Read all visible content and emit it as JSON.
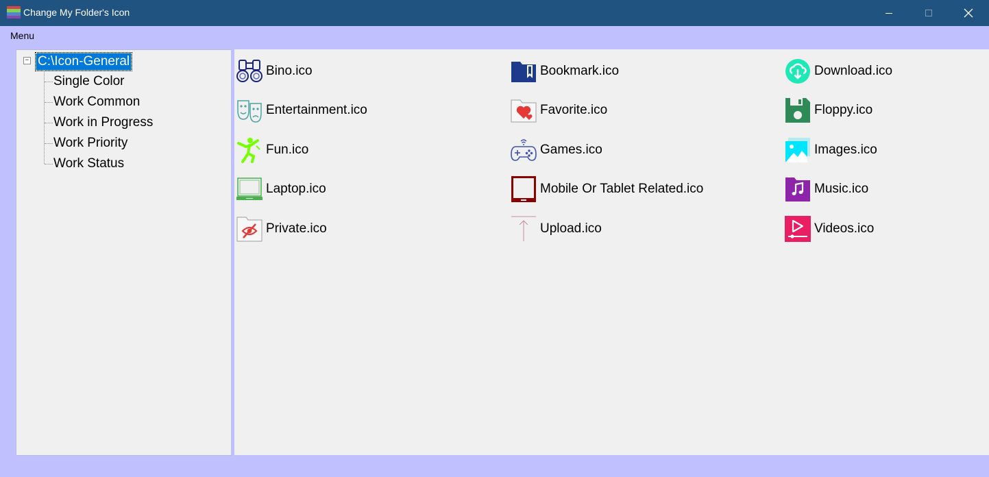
{
  "window": {
    "title": "Change My Folder's Icon"
  },
  "menubar": {
    "menu_label": "Menu"
  },
  "tree": {
    "root": "C:\\Icon-General",
    "children": [
      "Single Color",
      "Work Common",
      "Work in Progress",
      "Work Priority",
      "Work Status"
    ]
  },
  "files": [
    {
      "name": "Bino.ico",
      "icon": "binoculars-icon",
      "color": "#1a237e"
    },
    {
      "name": "Bookmark.ico",
      "icon": "bookmark-folder-icon",
      "color": "#1e3a8a"
    },
    {
      "name": "Download.ico",
      "icon": "download-cloud-icon",
      "color": "#1de9b6"
    },
    {
      "name": "Entertainment.ico",
      "icon": "theater-masks-icon",
      "color": "#4aa3a3"
    },
    {
      "name": "Favorite.ico",
      "icon": "heart-folder-icon",
      "color": "#e53935"
    },
    {
      "name": "Floppy.ico",
      "icon": "floppy-disk-icon",
      "color": "#2e8b57"
    },
    {
      "name": "Fun.ico",
      "icon": "dancing-person-icon",
      "color": "#76ff03"
    },
    {
      "name": "Games.ico",
      "icon": "gamepad-icon",
      "color": "#3f51b5"
    },
    {
      "name": "Images.ico",
      "icon": "image-icon",
      "color": "#00e5ff"
    },
    {
      "name": "Laptop.ico",
      "icon": "laptop-icon",
      "color": "#4caf50"
    },
    {
      "name": "Mobile Or Tablet Related.ico",
      "icon": "tablet-icon",
      "color": "#8b0000"
    },
    {
      "name": "Music.ico",
      "icon": "music-note-icon",
      "color": "#8e24aa"
    },
    {
      "name": "Private.ico",
      "icon": "private-eye-folder-icon",
      "color": "#e53935"
    },
    {
      "name": "Upload.ico",
      "icon": "upload-arrow-icon",
      "color": "#c48ba0"
    },
    {
      "name": "Videos.ico",
      "icon": "video-play-icon",
      "color": "#e91e63"
    }
  ]
}
